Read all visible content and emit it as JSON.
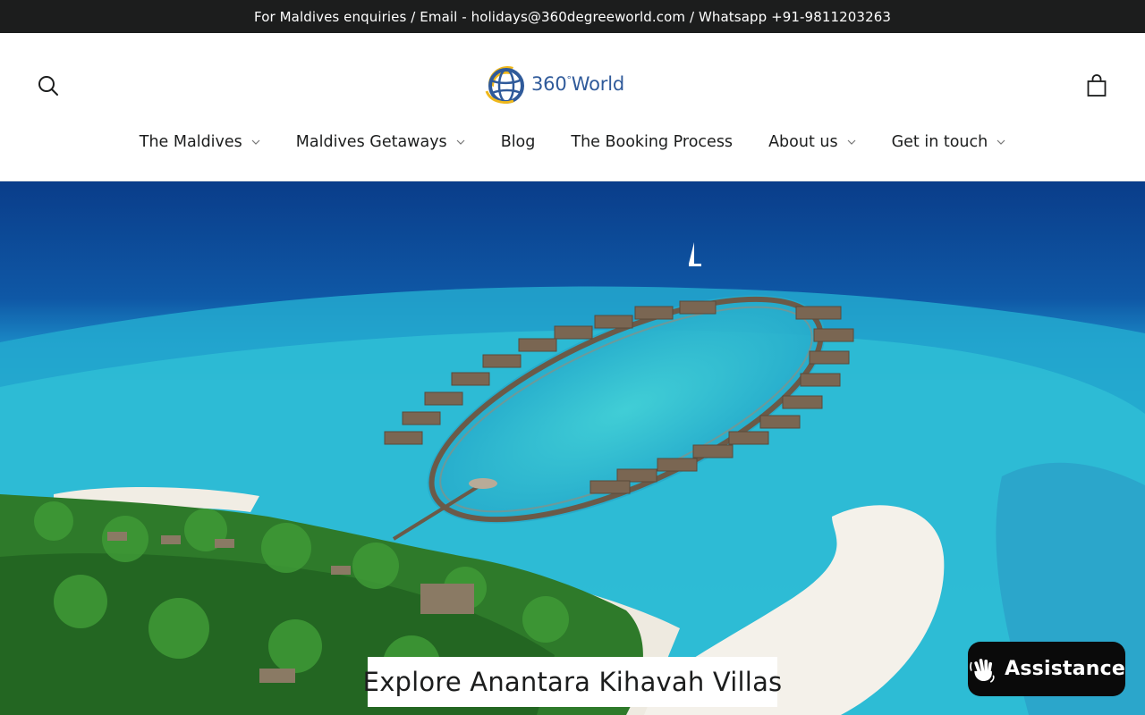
{
  "announcement": {
    "text": "For Maldives enquiries / Email - holidays@360degreeworld.com / Whatsapp +91-9811203263"
  },
  "header": {
    "logo": {
      "text": "360",
      "degree": "°",
      "suffix": "World"
    },
    "search_icon": "search-icon",
    "cart_icon": "bag-icon"
  },
  "nav": {
    "items": [
      {
        "label": "The Maldives",
        "has_dropdown": true
      },
      {
        "label": "Maldives Getaways",
        "has_dropdown": true
      },
      {
        "label": "Blog",
        "has_dropdown": false
      },
      {
        "label": "The Booking Process",
        "has_dropdown": false
      },
      {
        "label": "About us",
        "has_dropdown": true
      },
      {
        "label": "Get in touch",
        "has_dropdown": true
      }
    ]
  },
  "hero": {
    "caption": "Explore Anantara Kihavah Villas"
  },
  "assistance": {
    "label": "Assistance",
    "icon": "waving-hand-icon"
  },
  "colors": {
    "announcement_bg": "#1c1d1d",
    "logo_blue": "#2f5a9a",
    "logo_yellow": "#f0b81a",
    "assistance_bg": "#0a0a0a"
  }
}
